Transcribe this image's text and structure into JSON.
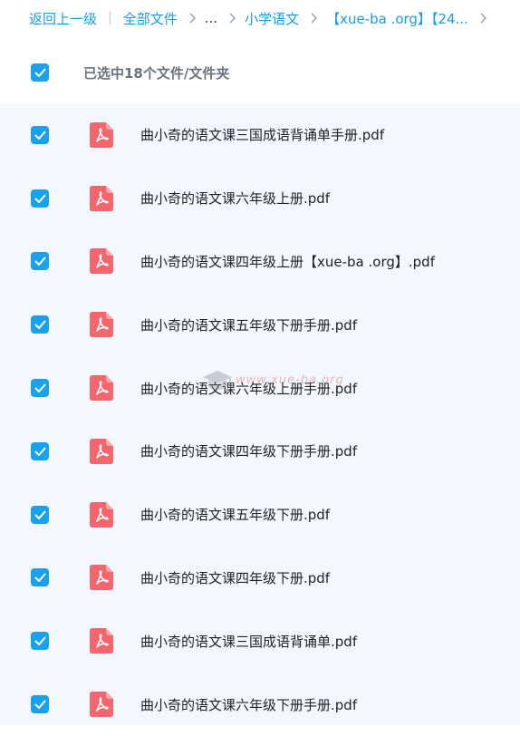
{
  "breadcrumb": {
    "back_label": "返回上一级",
    "items": [
      "全部文件",
      "...",
      "小学语文",
      "【xue-ba .org】【24..."
    ]
  },
  "header": {
    "selected_label": "已选中18个文件/文件夹"
  },
  "files": [
    {
      "name": "曲小奇的语文课三国成语背诵单手册.pdf",
      "checked": true
    },
    {
      "name": "曲小奇的语文课六年级上册.pdf",
      "checked": true
    },
    {
      "name": "曲小奇的语文课四年级上册【xue-ba .org】.pdf",
      "checked": true
    },
    {
      "name": "曲小奇的语文课五年级下册手册.pdf",
      "checked": true
    },
    {
      "name": "曲小奇的语文课六年级上册手册.pdf",
      "checked": true
    },
    {
      "name": "曲小奇的语文课四年级下册手册.pdf",
      "checked": true
    },
    {
      "name": "曲小奇的语文课五年级下册.pdf",
      "checked": true
    },
    {
      "name": "曲小奇的语文课四年级下册.pdf",
      "checked": true
    },
    {
      "name": "曲小奇的语文课三国成语背诵单.pdf",
      "checked": true
    },
    {
      "name": "曲小奇的语文课六年级下册手册.pdf",
      "checked": true
    }
  ],
  "watermark": {
    "text": "www.xue-ba.org"
  },
  "colors": {
    "accent": "#1aa1ee",
    "link": "#1a9be6",
    "pdf_red": "#f4656d",
    "list_bg": "#f2f8fd"
  },
  "icons": {
    "checkbox": "check-icon",
    "file": "pdf-file-icon",
    "separator": "chevron-right-icon"
  }
}
